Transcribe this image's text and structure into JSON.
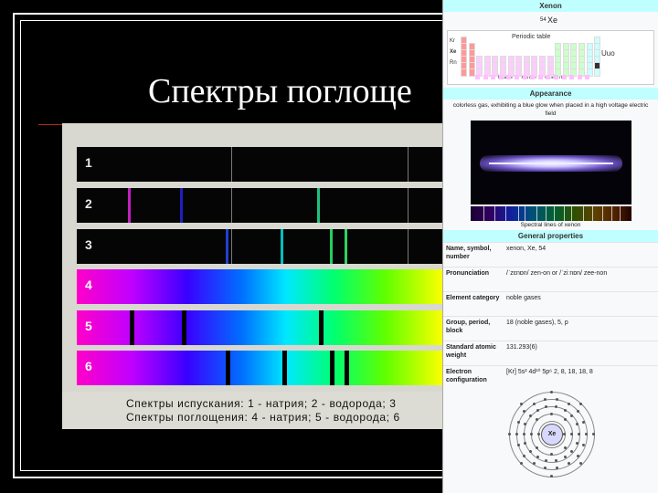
{
  "slide": {
    "title": "Спектры поглоще"
  },
  "spectra": {
    "strip_numbers": [
      "1",
      "2",
      "3",
      "4",
      "5",
      "6"
    ],
    "emission_lines": [
      [],
      [
        {
          "pos": 0.14,
          "color": "#c020c0"
        },
        {
          "pos": 0.28,
          "color": "#2020c0"
        },
        {
          "pos": 0.655,
          "color": "#20c080"
        }
      ],
      [
        {
          "pos": 0.405,
          "color": "#2040d0"
        },
        {
          "pos": 0.555,
          "color": "#00c0c0"
        },
        {
          "pos": 0.69,
          "color": "#20d060"
        },
        {
          "pos": 0.73,
          "color": "#30d060"
        }
      ],
      [],
      [],
      []
    ],
    "absorption_lines": [
      [],
      [],
      [],
      [],
      [
        {
          "pos": 0.145
        },
        {
          "pos": 0.285
        },
        {
          "pos": 0.66
        }
      ],
      [
        {
          "pos": 0.405
        },
        {
          "pos": 0.56
        },
        {
          "pos": 0.69
        },
        {
          "pos": 0.73
        }
      ]
    ],
    "legend_line1": "Спектры испускания: 1 - натрия; 2 - водорода; 3",
    "legend_line2": "Спектры поглощения: 4 - натрия; 5 - водорода; 6"
  },
  "infobox": {
    "header": "Xenon",
    "atomic_number": "54",
    "symbol": "Xe",
    "pt_title": "Periodic table",
    "pt_left_labels": [
      "Kr",
      "Xe",
      "Rn"
    ],
    "pt_right_label": "Uuo",
    "pt_nav": "iodine ← xenon → cesium",
    "appearance_header": "Appearance",
    "appearance_text": "colorless gas, exhibiting a blue glow when placed in a high voltage electric field",
    "photo_caption": "Spectral lines of xenon",
    "general_header": "General properties",
    "rows": [
      {
        "k": "Name, symbol, number",
        "v": "xenon, Xe, 54"
      },
      {
        "k": "Pronunciation",
        "v": "/ˈzɛnɒn/ zen-on or /ˈziːnɒn/ zee-non"
      },
      {
        "k": "Element category",
        "v": "noble gases"
      },
      {
        "k": "Group, period, block",
        "v": "18 (noble gases), 5, p"
      },
      {
        "k": "Standard atomic weight",
        "v": "131.293(6)"
      },
      {
        "k": "Electron configuration",
        "v": "[Kr] 5s² 4d¹⁰ 5p⁶  2, 8, 18, 18, 8"
      }
    ],
    "atom_label": "Xe"
  }
}
